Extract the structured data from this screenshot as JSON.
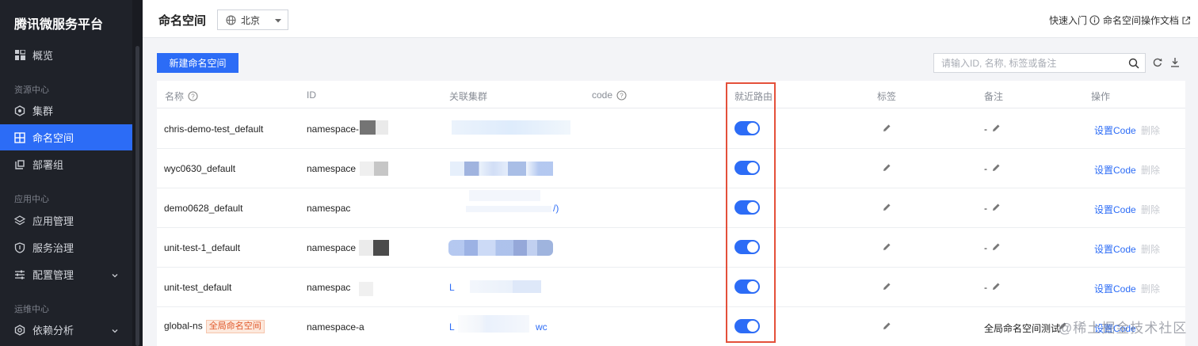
{
  "sidebar": {
    "brand": "腾讯微服务平台",
    "items": [
      {
        "label": "概览"
      },
      {
        "label": "集群"
      },
      {
        "label": "命名空间"
      },
      {
        "label": "部署组"
      },
      {
        "label": "应用管理"
      },
      {
        "label": "服务治理"
      },
      {
        "label": "配置管理"
      },
      {
        "label": "依赖分析"
      }
    ],
    "groups": [
      "资源中心",
      "应用中心",
      "运维中心"
    ]
  },
  "header": {
    "title": "命名空间",
    "region": "北京",
    "quick_start": "快速入门",
    "docs": "命名空间操作文档"
  },
  "toolbar": {
    "new_button": "新建命名空间",
    "search_placeholder": "请输入ID, 名称, 标签或备注"
  },
  "table": {
    "columns": {
      "name": "名称",
      "id": "ID",
      "cluster": "关联集群",
      "code": "code",
      "nearby": "就近路由",
      "tag": "标签",
      "remark": "备注",
      "action": "操作"
    },
    "rows": [
      {
        "name": "chris-demo-test_default",
        "id": "namespace-",
        "remark": "-",
        "badge": "",
        "cluster": "",
        "nearby": true
      },
      {
        "name": "wyc0630_default",
        "id": "namespace",
        "remark": "-",
        "badge": "",
        "cluster": "",
        "nearby": true
      },
      {
        "name": "demo0628_default",
        "id": "namespac",
        "remark": "-",
        "badge": "",
        "cluster": "/)",
        "nearby": true
      },
      {
        "name": "unit-test-1_default",
        "id": "namespace",
        "remark": "-",
        "badge": "",
        "cluster": "",
        "nearby": true
      },
      {
        "name": "unit-test_default",
        "id": "namespac",
        "remark": "-",
        "badge": "",
        "cluster": "L",
        "nearby": true
      },
      {
        "name": "global-ns",
        "id": "namespace-a",
        "remark": "全局命名空间测试",
        "badge": "全局命名空间",
        "cluster": "wc",
        "nearby": true
      }
    ],
    "set_code": "设置Code",
    "delete": "删除"
  },
  "watermark": "@稀土掘金技术社区",
  "colors": {
    "accent": "#2c6cf6",
    "sidebar_bg": "#1f2229",
    "highlight": "#e4503a",
    "badge": "#e0582a"
  }
}
